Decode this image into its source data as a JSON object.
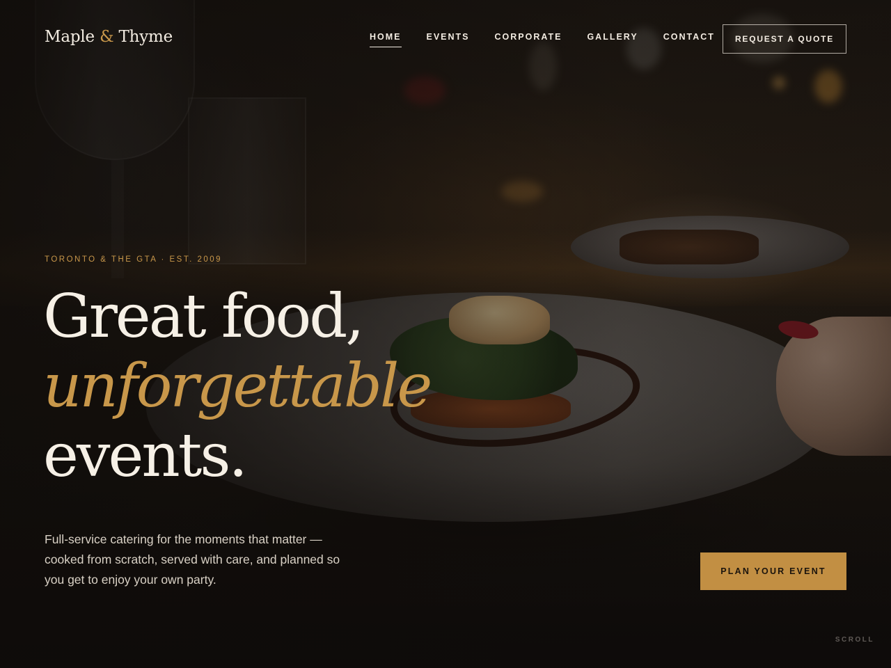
{
  "brand": {
    "name_part1": "Maple",
    "ampersand": "&",
    "name_part2": "Thyme",
    "accent_color": "#c8974a"
  },
  "nav": {
    "items": [
      {
        "label": "HOME",
        "active": true
      },
      {
        "label": "EVENTS",
        "active": false
      },
      {
        "label": "CORPORATE",
        "active": false
      },
      {
        "label": "GALLERY",
        "active": false
      },
      {
        "label": "CONTACT",
        "active": false
      }
    ],
    "quote_button": "REQUEST A QUOTE"
  },
  "hero": {
    "eyebrow": "TORONTO & THE GTA · EST. 2009",
    "headline_line1": "Great food,",
    "headline_line2": "unforgettable",
    "headline_line3": "events.",
    "lede": "Full-service catering for the moments that matter — cooked from scratch, served with care, and planned so you get to enjoy your own party.",
    "cta_label": "PLAN YOUR EVENT",
    "scroll_label": "SCROLL",
    "cta_color": "#c28f43"
  }
}
